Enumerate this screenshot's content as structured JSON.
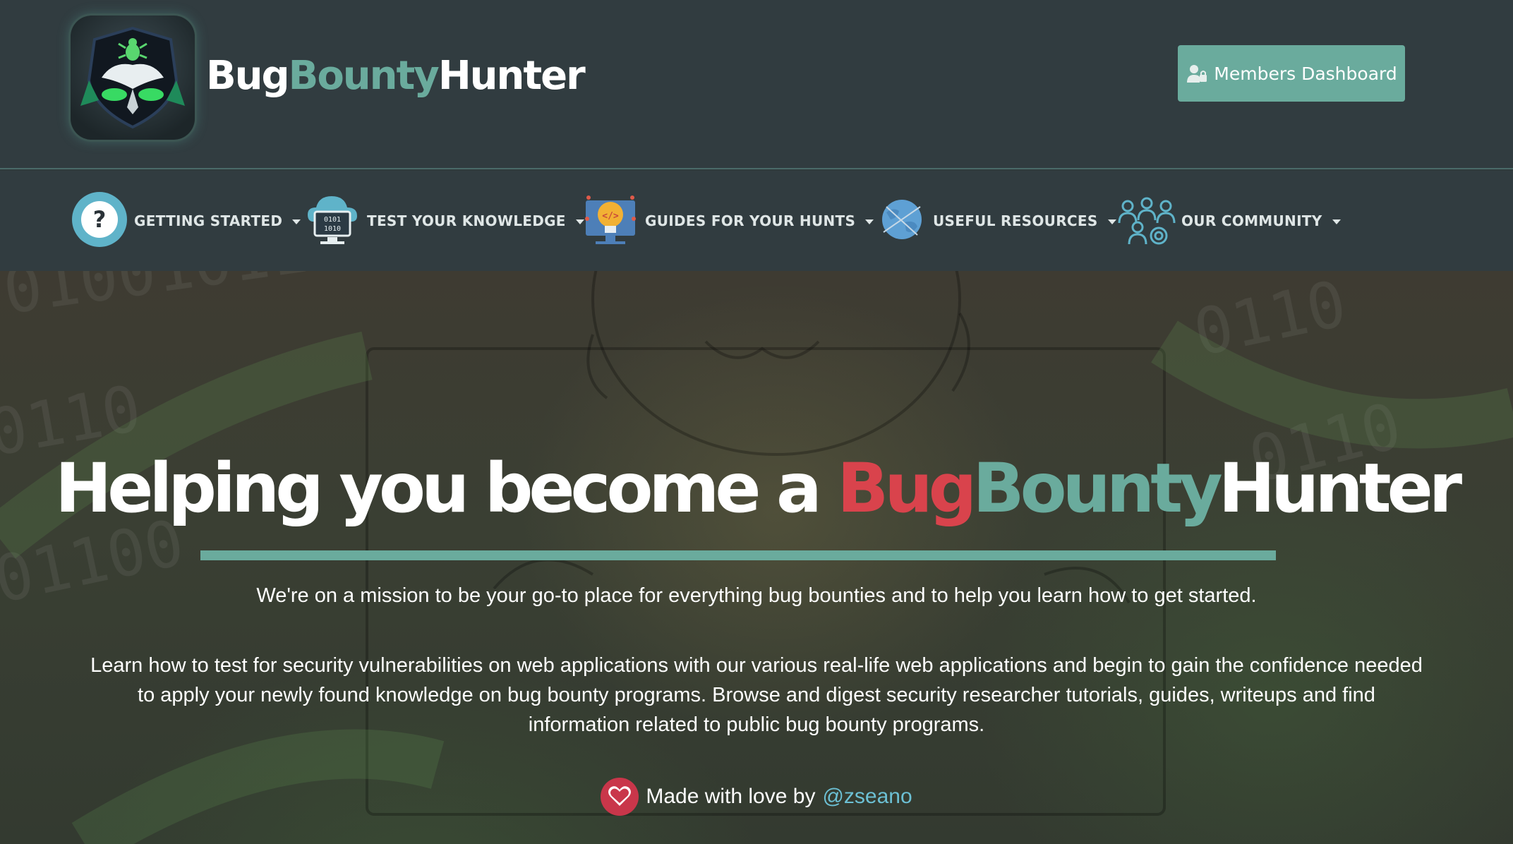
{
  "header": {
    "brand": {
      "part1": "Bug",
      "part2": "Bounty",
      "part3": "Hunter"
    },
    "members_button": {
      "label": "Members Dashboard",
      "icon": "user-lock-icon"
    }
  },
  "nav": {
    "items": [
      {
        "label": "GETTING STARTED",
        "icon": "question-circle-icon"
      },
      {
        "label": "TEST YOUR KNOWLEDGE",
        "icon": "cloud-computer-icon"
      },
      {
        "label": "GUIDES FOR YOUR HUNTS",
        "icon": "lightbulb-code-icon"
      },
      {
        "label": "USEFUL RESOURCES",
        "icon": "globe-icon"
      },
      {
        "label": "OUR COMMUNITY",
        "icon": "community-people-icon"
      }
    ]
  },
  "hero": {
    "headline_prefix": "Helping you become a ",
    "headline_bug": "Bug",
    "headline_bounty": "Bounty",
    "headline_hunter": "Hunter",
    "mission": "We're on a mission to be your go-to place for everything bug bounties and to help you learn how to get started.",
    "learn": "Learn how to test for security vulnerabilities on web applications with our various real-life web applications and begin to gain the confidence needed to apply your newly found knowledge on bug bounty programs. Browse and digest security researcher tutorials, guides, writeups and find information related to public bug bounty programs.",
    "made_with_love": "Made with love by",
    "author": "@zseano"
  },
  "colors": {
    "accent_green": "#6aab9d",
    "accent_red": "#d9434c",
    "header_bg": "#313c40",
    "link_blue": "#6cc0d4"
  }
}
